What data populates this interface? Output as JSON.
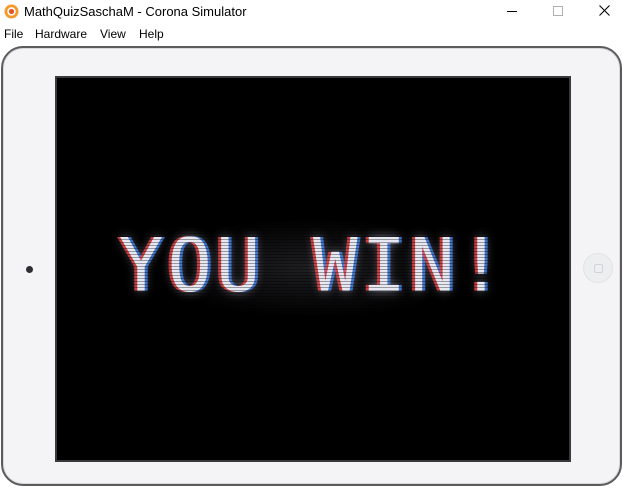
{
  "window": {
    "title": "MathQuizSaschaM - Corona Simulator",
    "app_icon": "corona-simulator-icon",
    "controls": {
      "minimize_icon": "minimize-icon",
      "maximize_icon": "maximize-icon",
      "close_icon": "close-icon"
    }
  },
  "menubar": {
    "items": [
      {
        "label": "File"
      },
      {
        "label": "Hardware"
      },
      {
        "label": "View"
      },
      {
        "label": "Help"
      }
    ]
  },
  "device": {
    "screen": {
      "message": "YOU WIN!",
      "background_color": "#000000",
      "text_color": "#e8e8f2"
    },
    "camera_icon": "camera-dot-icon",
    "home_button_icon": "home-button-icon"
  }
}
